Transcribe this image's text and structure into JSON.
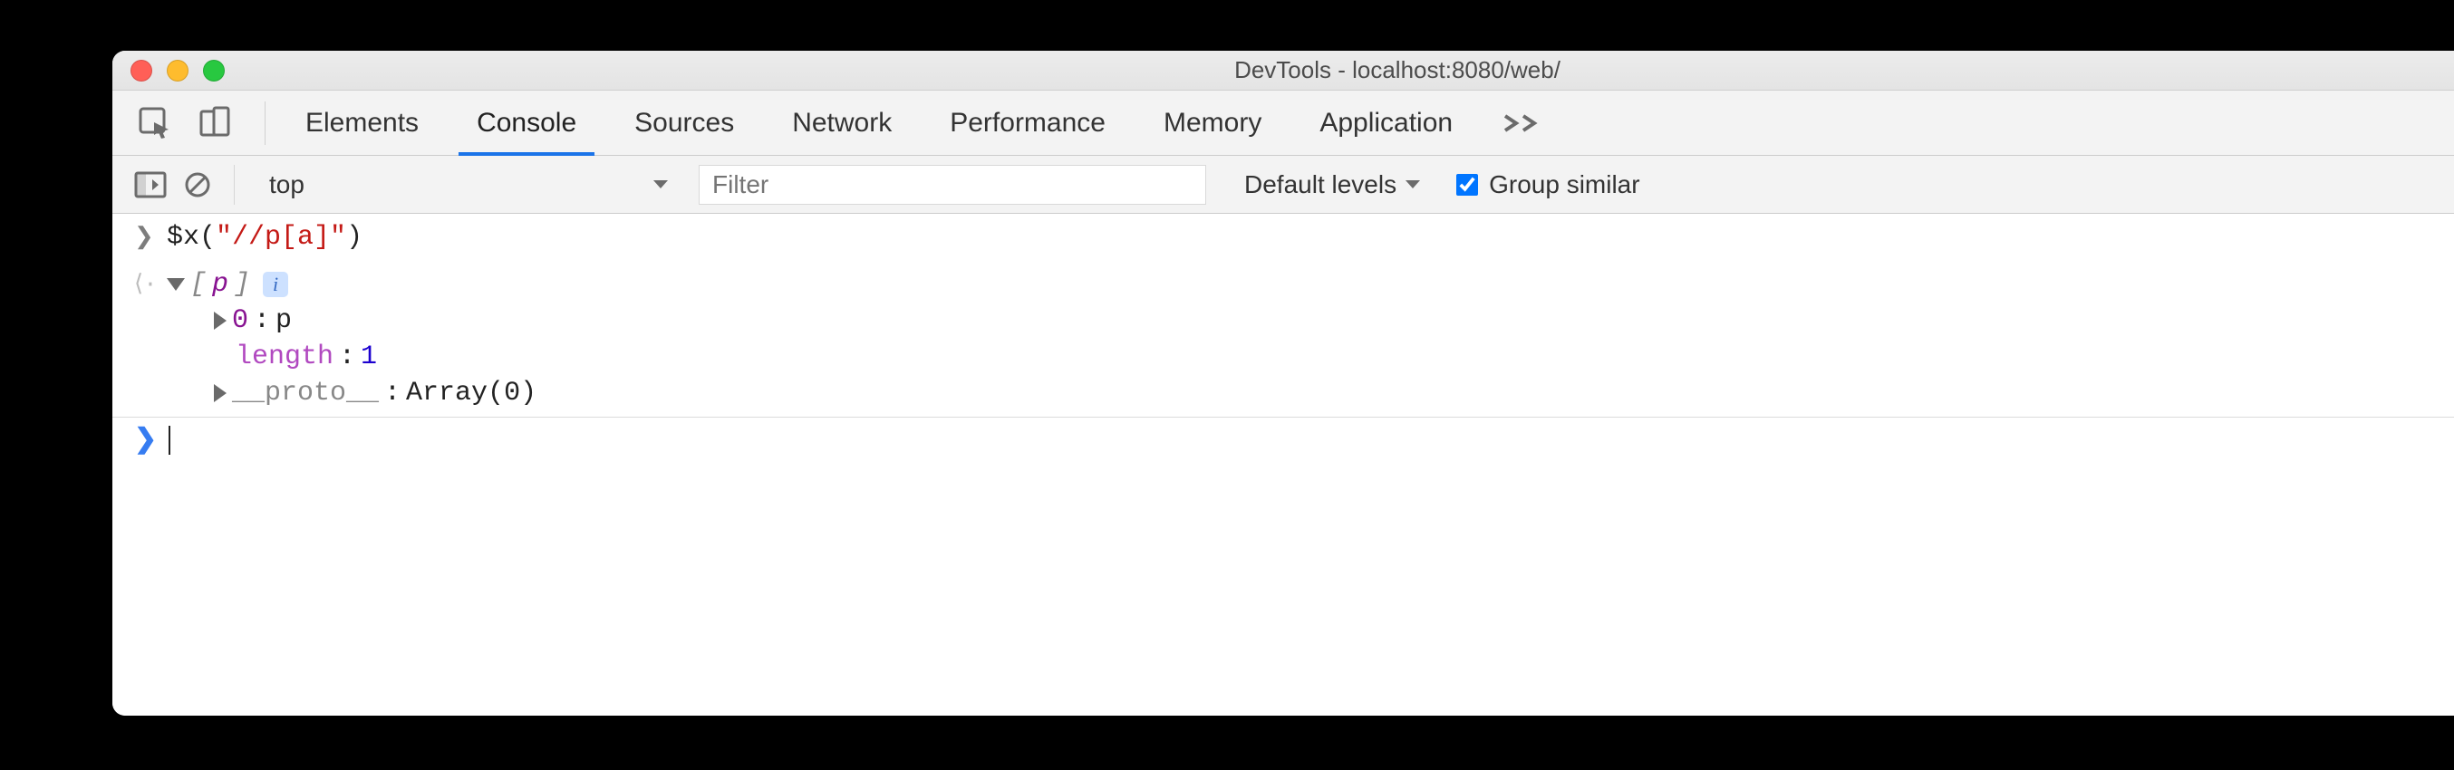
{
  "window": {
    "title": "DevTools - localhost:8080/web/"
  },
  "tabs": {
    "items": [
      "Elements",
      "Console",
      "Sources",
      "Network",
      "Performance",
      "Memory",
      "Application"
    ],
    "active": "Console"
  },
  "console_toolbar": {
    "context": "top",
    "filter_placeholder": "Filter",
    "levels_label": "Default levels",
    "group_similar_label": "Group similar",
    "group_similar_checked": true
  },
  "console": {
    "input": {
      "fn": "$x",
      "open": "(",
      "string": "\"//p[a]\"",
      "close": ")"
    },
    "result": {
      "summary_open": "[",
      "summary_element": "p",
      "summary_close": "]",
      "children": {
        "index0": {
          "key": "0",
          "sep": ": ",
          "value": "p"
        },
        "length": {
          "key": "length",
          "sep": ": ",
          "value": "1"
        },
        "proto": {
          "key": "__proto__",
          "sep": ": ",
          "value": "Array(0)"
        }
      }
    }
  }
}
